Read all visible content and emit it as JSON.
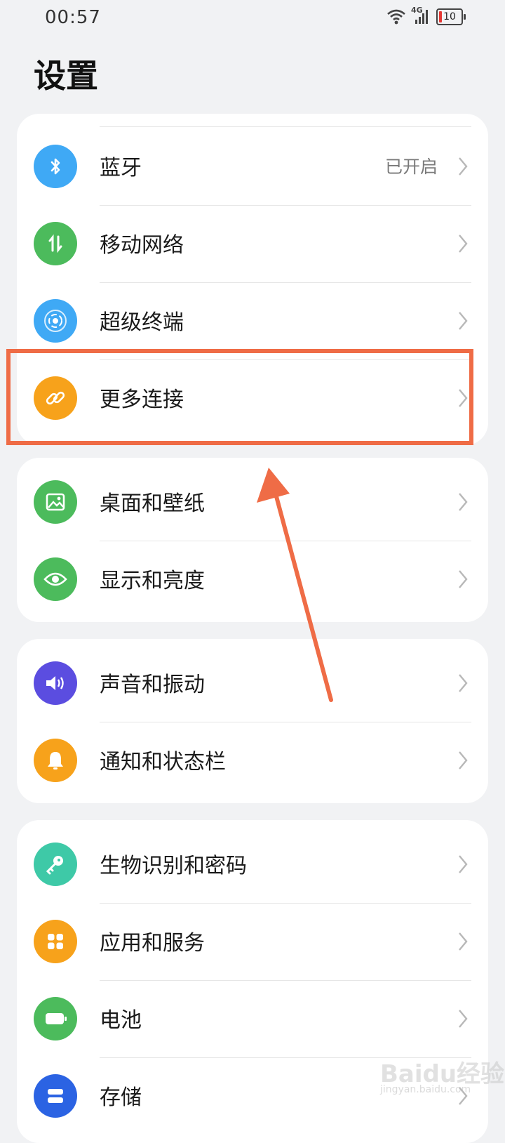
{
  "status_bar": {
    "time": "00:57",
    "network_label": "4G",
    "battery_level": "10"
  },
  "page": {
    "title": "设置"
  },
  "groups": [
    {
      "items": [
        {
          "label": "蓝牙",
          "value": "已开启",
          "icon": "bluetooth-icon",
          "color": "#3fa9f5"
        },
        {
          "label": "移动网络",
          "value": "",
          "icon": "mobile-data-icon",
          "color": "#4cbb5c"
        },
        {
          "label": "超级终端",
          "value": "",
          "icon": "super-device-icon",
          "color": "#3fa9f5"
        },
        {
          "label": "更多连接",
          "value": "",
          "icon": "link-icon",
          "color": "#f7a21b"
        }
      ]
    },
    {
      "items": [
        {
          "label": "桌面和壁纸",
          "value": "",
          "icon": "wallpaper-icon",
          "color": "#4cbb5c"
        },
        {
          "label": "显示和亮度",
          "value": "",
          "icon": "eye-icon",
          "color": "#4cbb5c"
        }
      ]
    },
    {
      "items": [
        {
          "label": "声音和振动",
          "value": "",
          "icon": "speaker-icon",
          "color": "#5b4de0"
        },
        {
          "label": "通知和状态栏",
          "value": "",
          "icon": "bell-icon",
          "color": "#f7a21b"
        }
      ]
    },
    {
      "items": [
        {
          "label": "生物识别和密码",
          "value": "",
          "icon": "key-icon",
          "color": "#3ec9a7"
        },
        {
          "label": "应用和服务",
          "value": "",
          "icon": "apps-icon",
          "color": "#f7a21b"
        },
        {
          "label": "电池",
          "value": "",
          "icon": "battery-icon",
          "color": "#4cbb5c"
        },
        {
          "label": "存储",
          "value": "",
          "icon": "storage-icon",
          "color": "#2b63e3"
        }
      ]
    }
  ],
  "annotation": {
    "highlight_color": "#ef6c46",
    "highlighted_item": "更多连接"
  },
  "watermark": {
    "logo_text": "Baidu经验",
    "url": "jingyan.baidu.com"
  }
}
